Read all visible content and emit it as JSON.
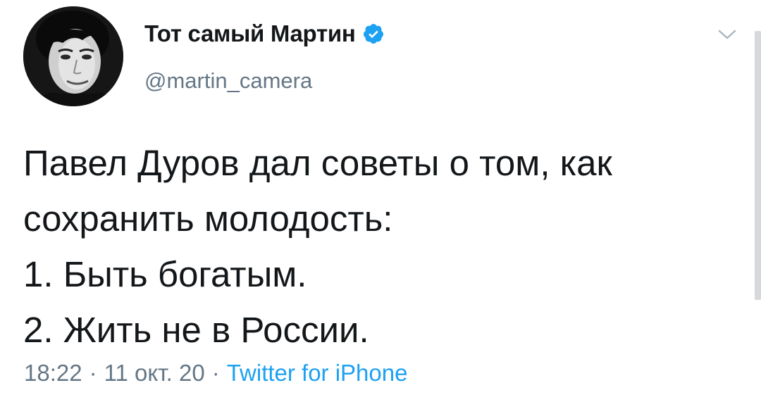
{
  "author": {
    "display_name": "Тот самый Мартин",
    "handle": "@martin_camera",
    "verified": true,
    "avatar_icon": "user-photo"
  },
  "tweet": {
    "lines": [
      "Павел Дуров дал советы о том, как",
      "сохранить молодость:",
      "1. Быть богатым.",
      "2. Жить не в России."
    ],
    "time": "18:22",
    "date": "11 окт. 20",
    "separator": "·",
    "source": "Twitter for iPhone"
  },
  "colors": {
    "text": "#14171a",
    "muted": "#657786",
    "accent": "#1da1f2"
  },
  "icons": {
    "verified": "verified-badge-icon",
    "menu": "chevron-down-icon"
  }
}
